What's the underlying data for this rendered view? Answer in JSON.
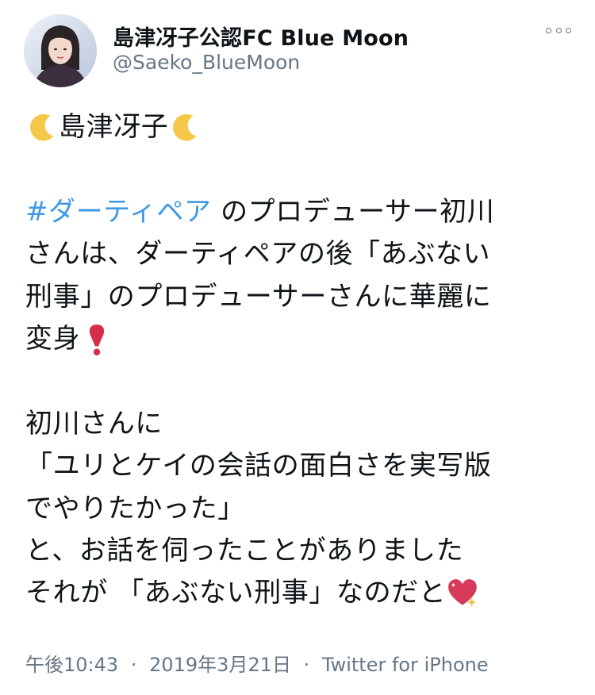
{
  "author": {
    "display_name": "島津冴子公認FC Blue Moon",
    "handle": "@Saeko_BlueMoon"
  },
  "tweet": {
    "title_name": "島津冴子",
    "hashtag": "#ダーティペア",
    "lines": {
      "l2_rest": " のプロデューサー初川",
      "l3": "さんは、ダーティペアの後「あぶない",
      "l4": "刑事」のプロデューサーさんに華麗に",
      "l5": "変身",
      "l6": "初川さんに",
      "l7": "「ユリとケイの会話の面白さを実写版",
      "l8": "でやりたかった」",
      "l9": "と、お話を伺ったことがありました",
      "l10": "それが 「あぶない刑事」なのだと"
    },
    "emojis": [
      "crescent-moon",
      "crescent-moon",
      "heavy-exclamation-mark",
      "sparkling-heart"
    ]
  },
  "meta": {
    "time": "午後10:43",
    "separator": "·",
    "date": "2019年3月21日",
    "source": "Twitter for iPhone"
  }
}
